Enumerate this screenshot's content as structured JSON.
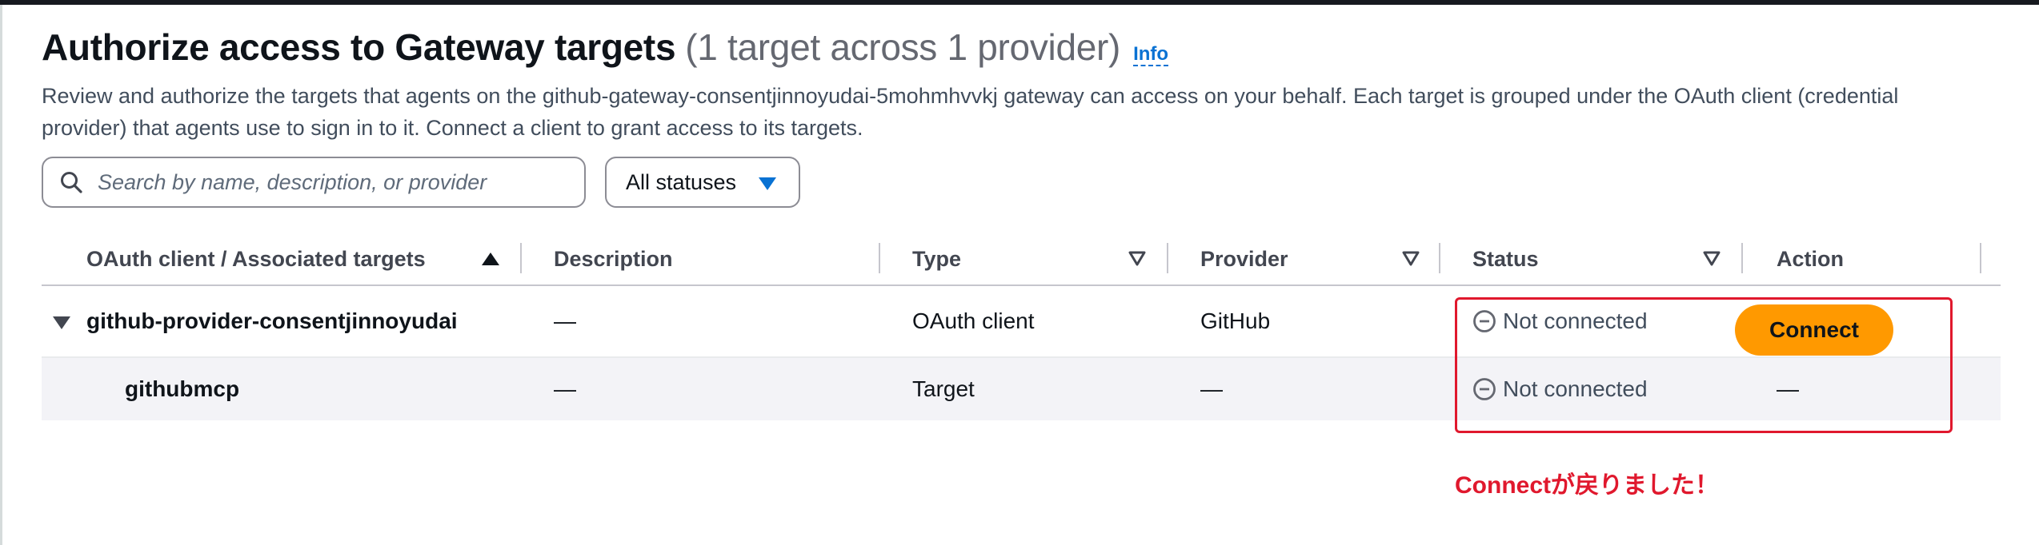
{
  "page": {
    "title": "Authorize access to Gateway targets",
    "counter": "(1 target across 1 provider)",
    "info_link": "Info",
    "description": "Review and authorize the targets that agents on the github-gateway-consentjinnoyudai-5mohmhvvkj gateway can access on your behalf. Each target is grouped under the OAuth client (credential provider) that agents use to sign in to it. Connect a client to grant access to its targets."
  },
  "filters": {
    "search_placeholder": "Search by name, description, or provider",
    "search_value": "",
    "status_select": "All statuses"
  },
  "table": {
    "columns": {
      "name": "OAuth client / Associated targets",
      "description": "Description",
      "type": "Type",
      "provider": "Provider",
      "status": "Status",
      "action": "Action"
    },
    "rows": [
      {
        "name": "github-provider-consentjinnoyudai",
        "description": "—",
        "type": "OAuth client",
        "provider": "GitHub",
        "status": "Not connected",
        "action": "Connect"
      },
      {
        "name": "githubmcp",
        "description": "—",
        "type": "Target",
        "provider": "—",
        "status": "Not connected",
        "action": "—"
      }
    ]
  },
  "annotation": {
    "text": "Connectが戻りました！",
    "color": "#e0182d"
  },
  "colors": {
    "accent": "#0972d3",
    "primary_button": "#ff9900",
    "status_text": "#414d5c"
  },
  "icons": {
    "search": "search-icon",
    "sort_ascending": "sort-ascending-icon",
    "sort_descending": "sort-descending-icon",
    "expand": "caret-down-icon",
    "status": "minus-circle-icon"
  }
}
